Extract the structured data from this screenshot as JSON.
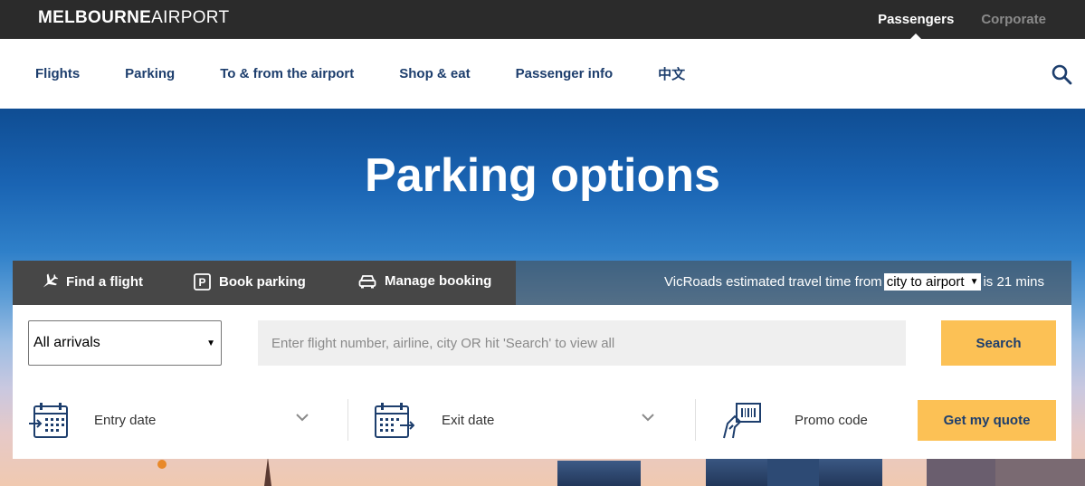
{
  "header": {
    "logo_bold": "MELBOURNE",
    "logo_thin": "AIRPORT",
    "top_links": [
      {
        "label": "Passengers",
        "active": true
      },
      {
        "label": "Corporate",
        "active": false
      }
    ]
  },
  "nav": {
    "items": [
      "Flights",
      "Parking",
      "To & from the airport",
      "Shop & eat",
      "Passenger info",
      "中文"
    ]
  },
  "hero": {
    "title": "Parking options"
  },
  "booking": {
    "tabs": [
      {
        "label": "Find a flight",
        "icon": "plane-icon"
      },
      {
        "label": "Book parking",
        "icon": "parking-icon"
      },
      {
        "label": "Manage booking",
        "icon": "car-icon"
      }
    ],
    "travel_prefix": "VicRoads estimated travel time from",
    "travel_route": "city to airport",
    "travel_suffix": "is 21 mins",
    "arrivals_select": "All arrivals",
    "flight_placeholder": "Enter flight number, airline, city OR hit 'Search' to view all",
    "search_label": "Search",
    "entry_label": "Entry date",
    "exit_label": "Exit date",
    "promo_label": "Promo code",
    "quote_label": "Get my quote"
  },
  "colors": {
    "navy": "#1d3e6d",
    "accent_yellow": "#fcc155",
    "topbar": "#2b2b2b"
  }
}
